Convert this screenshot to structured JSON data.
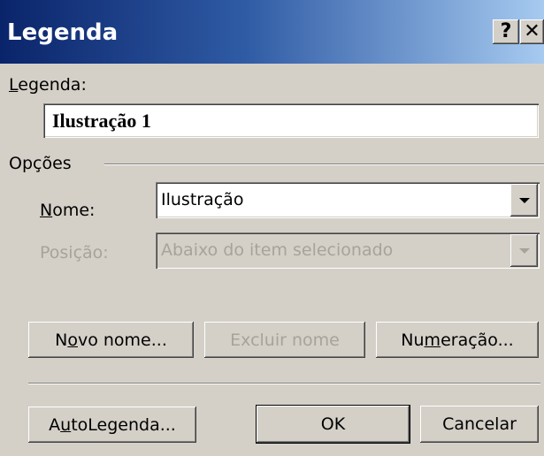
{
  "window": {
    "title": "Legenda",
    "help_glyph": "?",
    "close_glyph": "✕"
  },
  "caption": {
    "label_prefix": "",
    "label_underlined": "L",
    "label_suffix": "egenda:",
    "value": "Ilustração 1"
  },
  "options": {
    "group_label": "Opções",
    "name": {
      "label_underlined": "N",
      "label_suffix": "ome:",
      "value": "Ilustração"
    },
    "position": {
      "label": "Posição:",
      "value": "Abaixo do item selecionado",
      "disabled": true
    }
  },
  "buttons": {
    "new_name": {
      "prefix": "N",
      "underlined": "o",
      "suffix": "vo nome..."
    },
    "delete_name": {
      "label": "Excluir nome",
      "disabled": true
    },
    "numbering": {
      "prefix": "Nu",
      "underlined": "m",
      "suffix": "eração..."
    },
    "autocaption": {
      "prefix": "A",
      "underlined": "u",
      "suffix": "toLegenda..."
    },
    "ok": {
      "label": "OK"
    },
    "cancel": {
      "label": "Cancelar"
    }
  },
  "colors": {
    "title_gradient_start": "#0a246a",
    "title_gradient_end": "#a6caf0",
    "dialog_face": "#d4d0c8",
    "disabled_text": "#a6a39b"
  }
}
